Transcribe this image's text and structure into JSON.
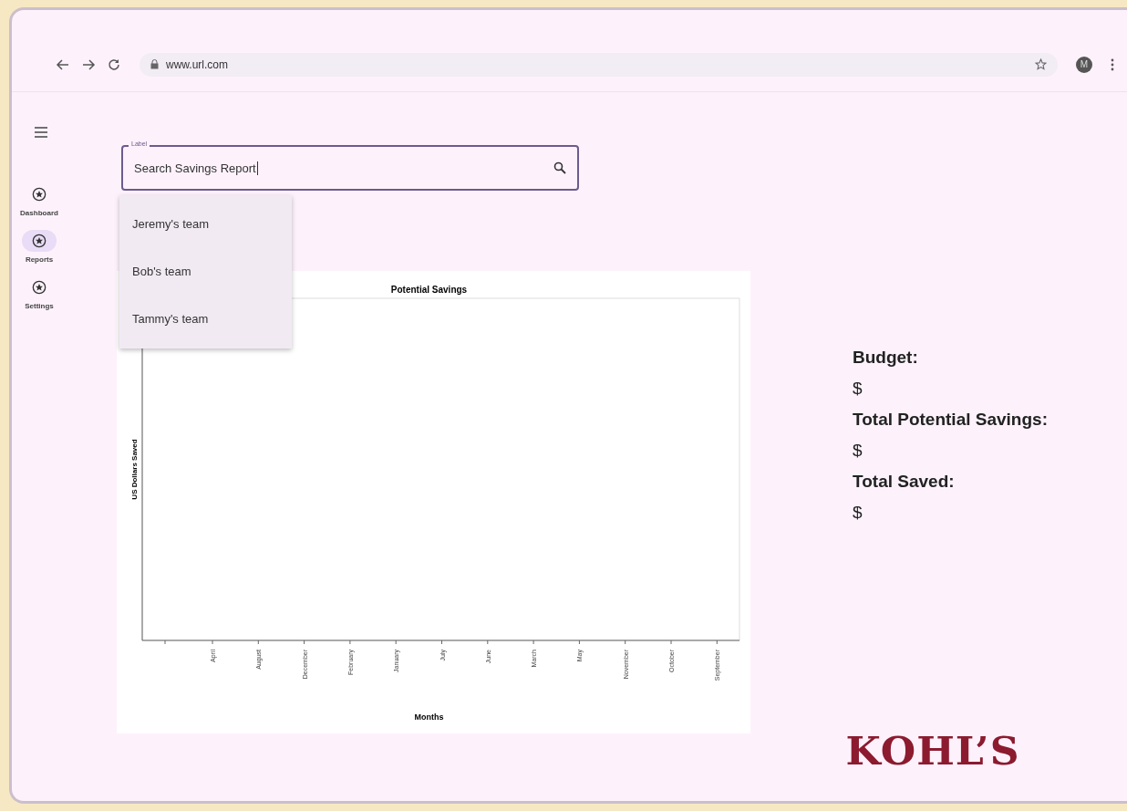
{
  "browser": {
    "url": "www.url.com",
    "avatar": "M"
  },
  "sidebar": {
    "items": [
      {
        "label": "Dashboard",
        "selected": false
      },
      {
        "label": "Reports",
        "selected": true
      },
      {
        "label": "Settings",
        "selected": false
      }
    ]
  },
  "search": {
    "label": "Label",
    "value": "Search Savings Report",
    "suggestions": [
      "Jeremy's team",
      "Bob's team",
      "Tammy's team"
    ]
  },
  "chart": {
    "title": "Potential Savings",
    "x_axis_title": "Months",
    "y_axis_title": "US Dollars Saved",
    "x_labels": [
      "April",
      "August",
      "December",
      "February",
      "January",
      "July",
      "June",
      "March",
      "May",
      "November",
      "October",
      "September"
    ]
  },
  "summary": [
    {
      "label": "Budget:",
      "value": "$"
    },
    {
      "label": "Total Potential Savings:",
      "value": "$"
    },
    {
      "label": "Total Saved:",
      "value": "$"
    }
  ],
  "logo": "KOHL’S"
}
